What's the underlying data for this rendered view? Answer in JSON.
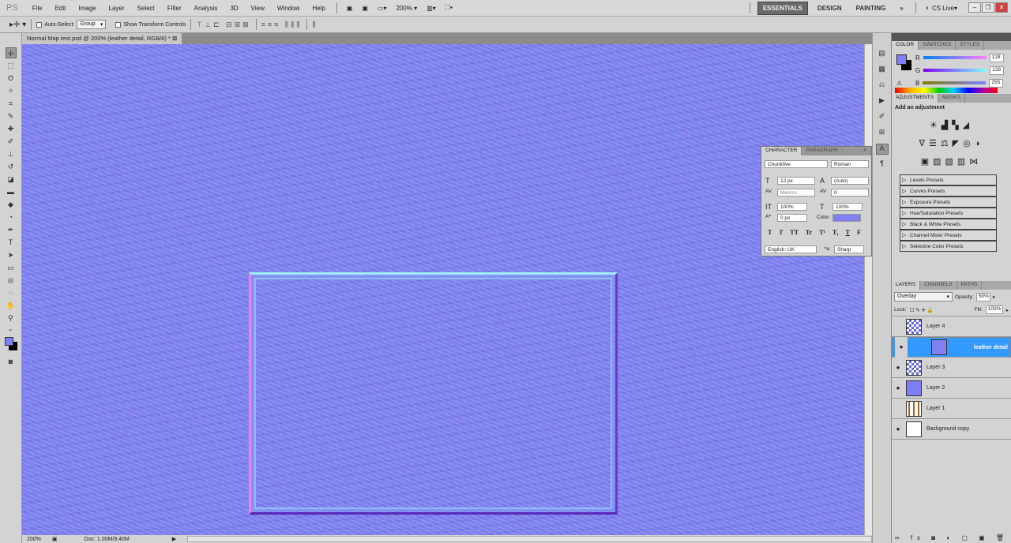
{
  "menubar": {
    "logo": "PS",
    "items": [
      "File",
      "Edit",
      "Image",
      "Layer",
      "Select",
      "Filter",
      "Analysis",
      "3D",
      "View",
      "Window",
      "Help"
    ],
    "zoom": "200%",
    "workspaces": [
      "ESSENTIALS",
      "DESIGN",
      "PAINTING"
    ],
    "more": "»",
    "cs_live": "CS Live"
  },
  "options": {
    "auto_select": "Auto-Select:",
    "auto_select_value": "Group",
    "show_transform": "Show Transform Controls"
  },
  "document": {
    "tab_title": "Normal Map test.psd @ 200% (leather detail, RGB/8) *"
  },
  "status": {
    "zoom": "200%",
    "doc": "Doc: 1.00M/9.40M"
  },
  "color_panel": {
    "tabs": [
      "COLOR",
      "SWATCHES",
      "STYLES"
    ],
    "r_label": "R",
    "r": "128",
    "g_label": "G",
    "g": "128",
    "b_label": "B",
    "b": "255",
    "fg": "#8080ff",
    "bg": "#000000"
  },
  "adjustments": {
    "tabs": [
      "ADJUSTMENTS",
      "MASKS"
    ],
    "heading": "Add an adjustment",
    "presets": [
      "Levels Presets",
      "Curves Presets",
      "Exposure Presets",
      "Hue/Saturation Presets",
      "Black & White Presets",
      "Channel Mixer Presets",
      "Selective Color Presets"
    ]
  },
  "character": {
    "tabs": [
      "CHARACTER",
      "PARAGRAPH"
    ],
    "font": "Chunkfive",
    "style": "Roman",
    "size": "12 px",
    "leading": "(Auto)",
    "kerning": "Metrics",
    "tracking": "0",
    "vscale": "100%",
    "hscale": "100%",
    "baseline": "0 px",
    "color_label": "Color:",
    "color": "#8080f0",
    "styles": [
      "T",
      "T",
      "TT",
      "Tr",
      "T¹",
      "T₁",
      "T",
      "F"
    ],
    "language": "English: UK",
    "aa_label": "ªa",
    "aa": "Sharp"
  },
  "layers": {
    "tabs": [
      "LAYERS",
      "CHANNELS",
      "PATHS"
    ],
    "blend": "Overlay",
    "opacity_label": "Opacity:",
    "opacity": "50%",
    "lock_label": "Lock:",
    "fill_label": "Fill:",
    "fill": "100%",
    "items": [
      {
        "name": "Layer 4",
        "visible": false
      },
      {
        "name": "leather detail",
        "visible": true
      },
      {
        "name": "Layer 3",
        "visible": true
      },
      {
        "name": "Layer 2",
        "visible": true
      },
      {
        "name": "Layer 1",
        "visible": false
      },
      {
        "name": "Background copy",
        "visible": true
      }
    ]
  }
}
